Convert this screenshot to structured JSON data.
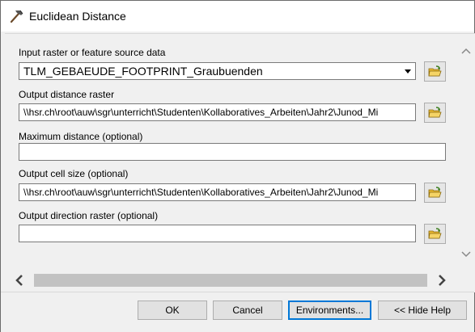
{
  "window": {
    "title": "Euclidean Distance",
    "title_icon": "hammer-icon"
  },
  "form": {
    "input_label": "Input raster or feature source data",
    "input_value": "TLM_GEBAEUDE_FOOTPRINT_Graubuenden",
    "output_distance_label": "Output distance raster",
    "output_distance_value": "\\\\hsr.ch\\root\\auw\\sgr\\unterricht\\Studenten\\Kollaboratives_Arbeiten\\Jahr2\\Junod_Mi",
    "max_distance_label": "Maximum distance (optional)",
    "max_distance_value": "",
    "cell_size_label": "Output cell size (optional)",
    "cell_size_value": "\\\\hsr.ch\\root\\auw\\sgr\\unterricht\\Studenten\\Kollaboratives_Arbeiten\\Jahr2\\Junod_Mi",
    "direction_label": "Output direction raster (optional)",
    "direction_value": ""
  },
  "buttons": {
    "ok": "OK",
    "cancel": "Cancel",
    "environments": "Environments...",
    "hide_help": "<< Hide Help"
  },
  "icons": {
    "browse": "folder-open-icon"
  },
  "colors": {
    "folder": "#e8b830",
    "arrow": "#3a7d1c",
    "focus_border": "#0078d7"
  }
}
